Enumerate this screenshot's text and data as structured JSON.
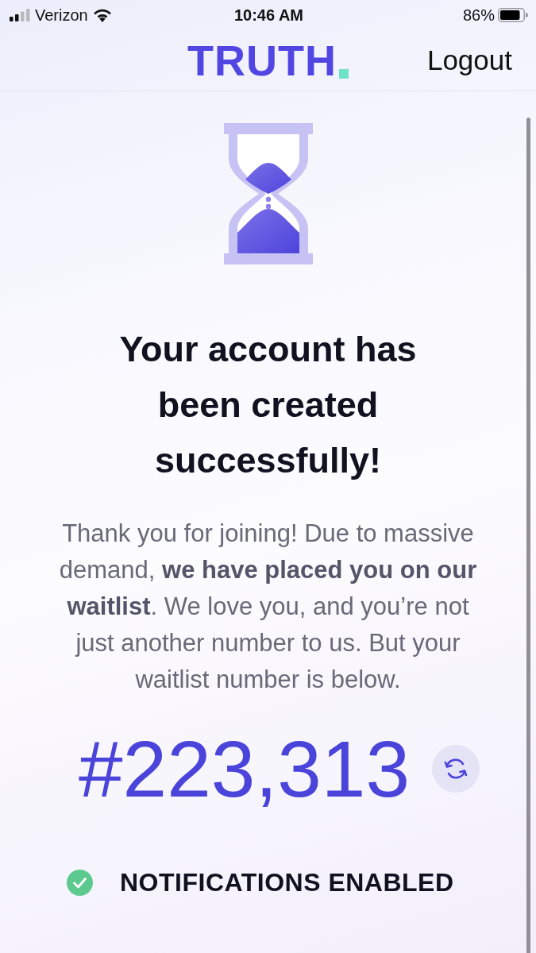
{
  "status_bar": {
    "carrier": "Verizon",
    "time": "10:46 AM",
    "battery": "86%"
  },
  "header": {
    "logo": "TRUTH",
    "logout": "Logout"
  },
  "content": {
    "title": "Your account has been created successfully!",
    "message": "Thank you for joining! Due to massive demand, **we have placed you on our waitlist**. We love you, and you’re not just another number to us. But your waitlist number is below.",
    "waitlist_number": "#223,313"
  },
  "notifications": {
    "label": "NOTIFICATIONS ENABLED",
    "enabled": true
  }
}
